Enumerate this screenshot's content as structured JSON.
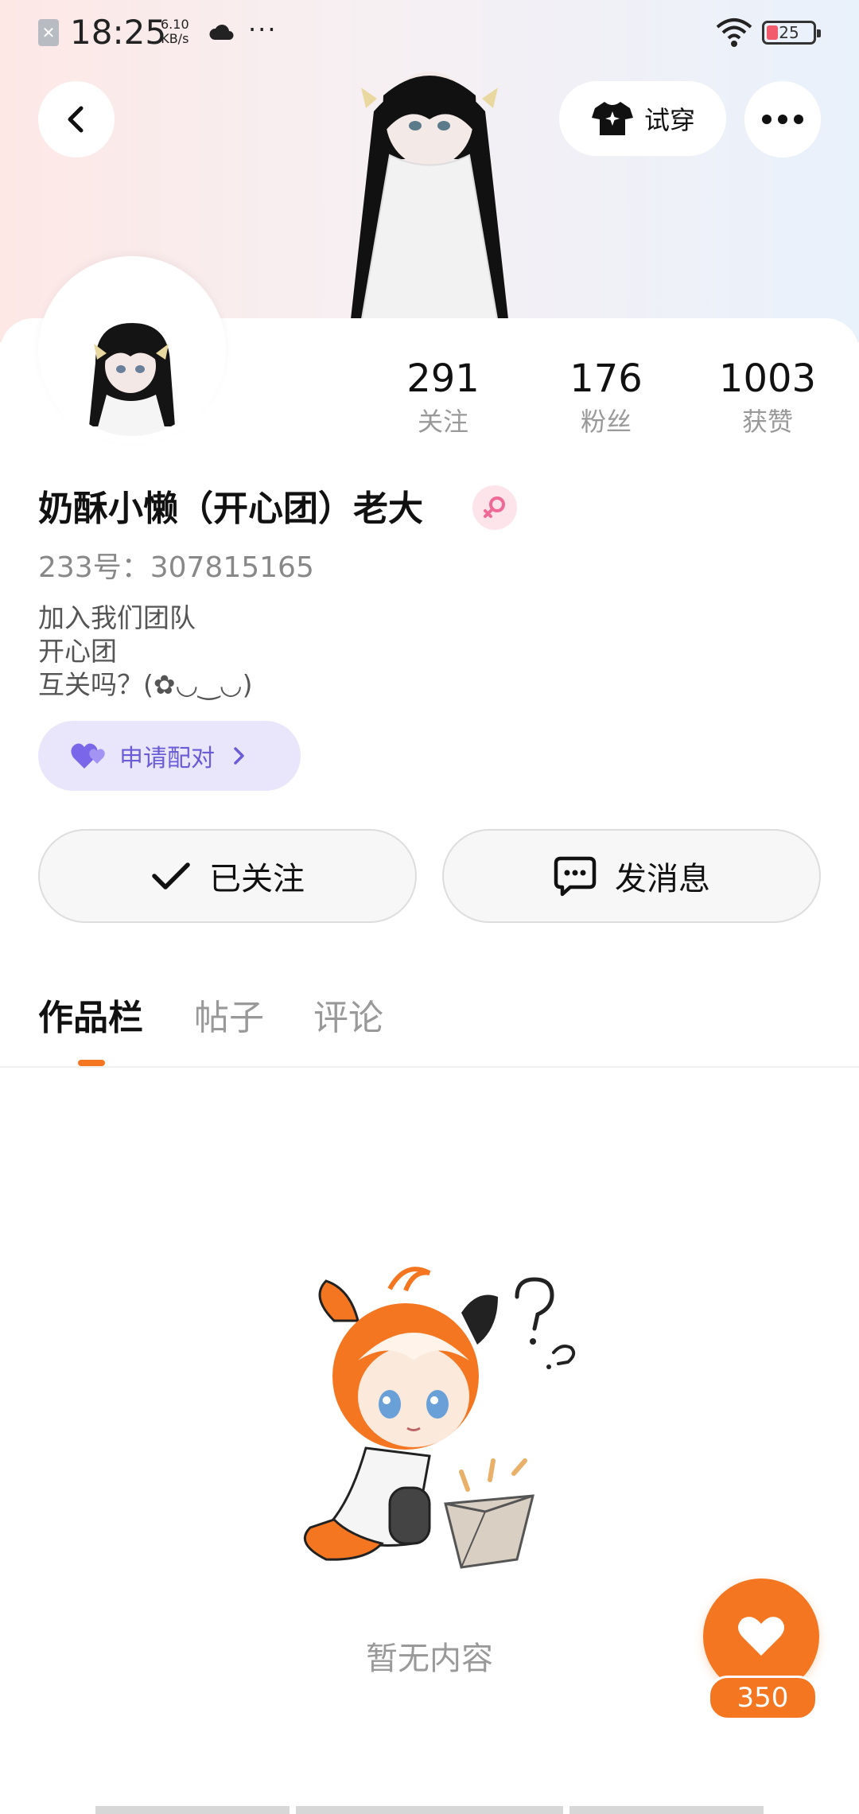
{
  "status_bar": {
    "time": "18:25",
    "speed_value": "6.10",
    "speed_unit": "KB/s",
    "more_dots": "···",
    "battery": "25",
    "battery_level": 0.25
  },
  "header": {
    "try_on_label": "试穿"
  },
  "profile": {
    "stats": [
      {
        "value": "291",
        "label": "关注"
      },
      {
        "value": "176",
        "label": "粉丝"
      },
      {
        "value": "1003",
        "label": "获赞"
      }
    ],
    "name": "奶酥小懒（开心团）老大",
    "id_line": "233号：307815165",
    "bio_lines": [
      "加入我们团队",
      "开心团",
      "互关吗？(✿◡‿◡)"
    ],
    "match_label": "申请配对",
    "followed_label": "已关注",
    "message_label": "发消息"
  },
  "tabs": [
    {
      "label": "作品栏",
      "active": true
    },
    {
      "label": "帖子",
      "active": false
    },
    {
      "label": "评论",
      "active": false
    }
  ],
  "content": {
    "empty_text": "暂无内容"
  },
  "like_button": {
    "count": "350"
  },
  "colors": {
    "accent": "#f47621",
    "match_bg": "#e9e6fb",
    "match_text": "#6a5bd6",
    "gender_bg": "#fde3ea"
  }
}
